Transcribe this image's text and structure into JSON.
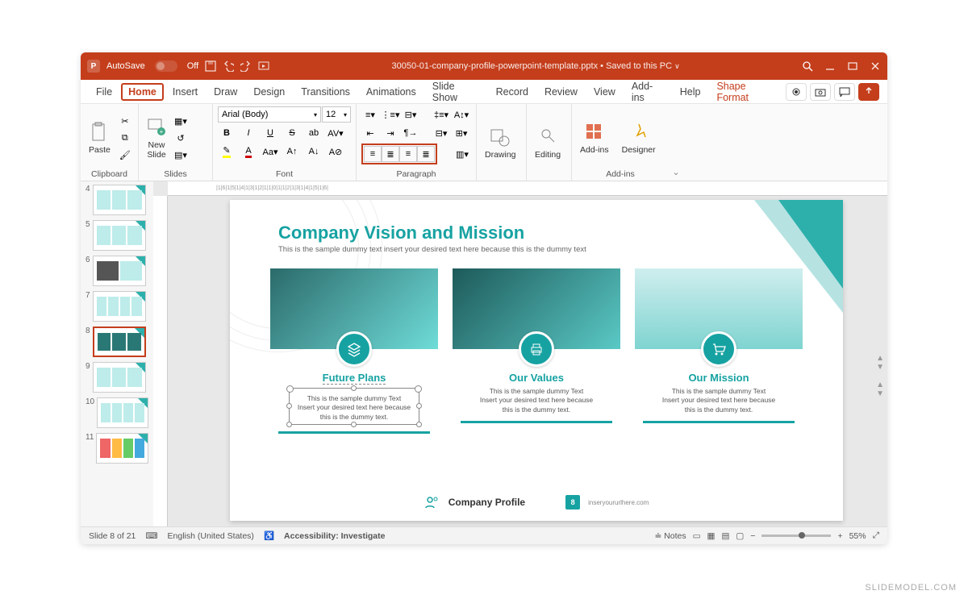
{
  "titlebar": {
    "autosave_label": "AutoSave",
    "autosave_state": "Off",
    "filename": "30050-01-company-profile-powerpoint-template.pptx",
    "saved": "Saved to this PC"
  },
  "menu": {
    "file": "File",
    "home": "Home",
    "insert": "Insert",
    "draw": "Draw",
    "design": "Design",
    "transitions": "Transitions",
    "animations": "Animations",
    "slideshow": "Slide Show",
    "record": "Record",
    "review": "Review",
    "view": "View",
    "addins": "Add-ins",
    "help": "Help",
    "shape": "Shape Format"
  },
  "ribbon": {
    "clipboard": {
      "label": "Clipboard",
      "paste": "Paste"
    },
    "slides": {
      "label": "Slides",
      "new": "New\nSlide"
    },
    "font": {
      "label": "Font",
      "name": "Arial (Body)",
      "size": "12"
    },
    "paragraph": {
      "label": "Paragraph"
    },
    "drawing": "Drawing",
    "editing": "Editing",
    "addins": {
      "label": "Add-ins",
      "btn": "Add-ins"
    },
    "designer": "Designer"
  },
  "thumbs": [
    "4",
    "5",
    "6",
    "7",
    "8",
    "9",
    "10",
    "11"
  ],
  "slide": {
    "title": "Company Vision and Mission",
    "subtitle": "This is the sample dummy text insert your desired text here because this is the dummy text",
    "cards": [
      {
        "title": "Future Plans",
        "desc": "This is the sample dummy Text\nInsert your desired text here because\nthis is the dummy text."
      },
      {
        "title": "Our Values",
        "desc": "This is the sample dummy Text\nInsert your desired text here because\nthis is the dummy text."
      },
      {
        "title": "Our Mission",
        "desc": "This is the sample dummy Text\nInsert your desired text here because\nthis is the dummy text."
      }
    ],
    "footer": {
      "company": "Company Profile",
      "page": "8",
      "url": "inseryoururlhere.com"
    }
  },
  "status": {
    "slide": "Slide 8 of 21",
    "lang": "English (United States)",
    "access": "Accessibility: Investigate",
    "notes": "Notes",
    "zoom": "55%"
  },
  "watermark": "SLIDEMODEL.COM"
}
